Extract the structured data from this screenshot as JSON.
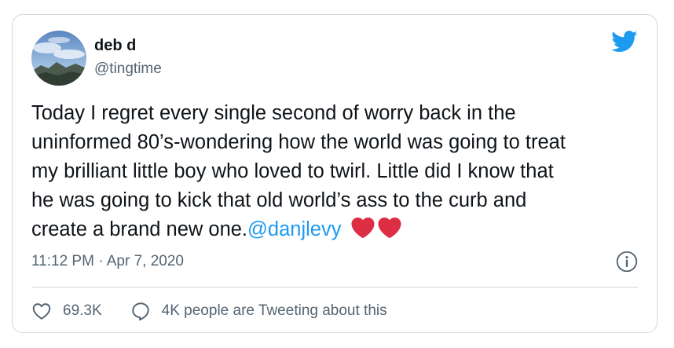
{
  "author": {
    "name": "deb d",
    "handle": "@tingtime"
  },
  "icons": {
    "brand": "twitter-bird-icon",
    "info": "info-icon",
    "like": "heart-outline-icon",
    "reply": "speech-bubble-icon",
    "emoji": "red-heart-emoji"
  },
  "tweet": {
    "lines": [
      "Today I regret every single second of worry back in the",
      "uninformed 80’s-wondering how the world was going to treat",
      "my brilliant little boy who loved to twirl. Little did I know that",
      "he was going to kick that old world’s ass to the curb and",
      "create a brand new one."
    ],
    "mention": "@danjlevy",
    "timestamp": "11:12 PM · Apr 7, 2020"
  },
  "actions": {
    "likes": "69.3K",
    "conversation": "4K people are Tweeting about this"
  },
  "colors": {
    "text": "#0f1419",
    "secondary": "#536471",
    "link": "#1d9bf0",
    "brand": "#1d9bf0",
    "heart": "#dd2e44",
    "border": "#cfd9de"
  }
}
